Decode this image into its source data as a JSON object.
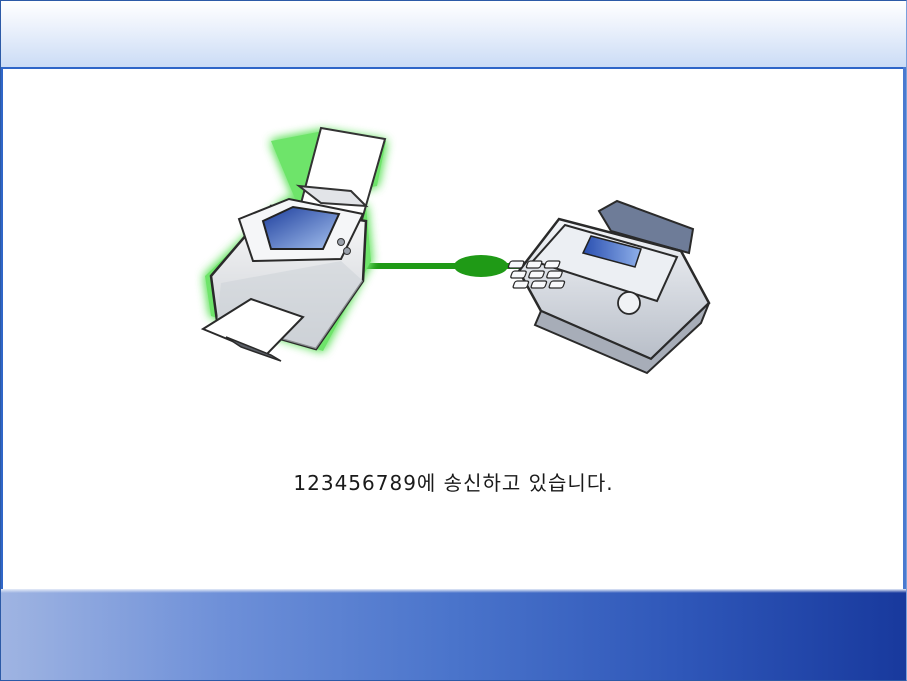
{
  "status": {
    "message": "123456789에 송신하고 있습니다."
  },
  "illustration": {
    "source_device": "scanner-icon",
    "destination_device": "fax-machine-icon",
    "connection": "connection-line",
    "highlight_color": "#3cd83c",
    "line_color": "#1f9a16"
  },
  "colors": {
    "header_gradient_end": "#cbdcf6",
    "accent_blue": "#2f66c8",
    "footer_dark": "#18399d",
    "footer_light": "#9fb4e2"
  }
}
